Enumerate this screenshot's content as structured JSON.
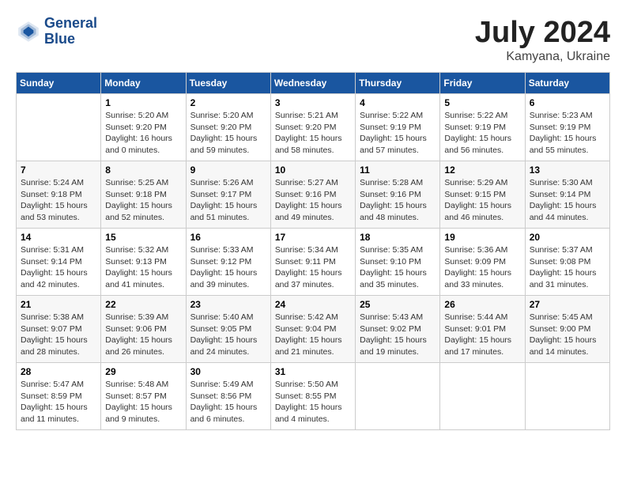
{
  "header": {
    "logo_line1": "General",
    "logo_line2": "Blue",
    "main_title": "July 2024",
    "subtitle": "Kamyana, Ukraine"
  },
  "calendar": {
    "weekdays": [
      "Sunday",
      "Monday",
      "Tuesday",
      "Wednesday",
      "Thursday",
      "Friday",
      "Saturday"
    ],
    "weeks": [
      [
        {
          "day": "",
          "sunrise": "",
          "sunset": "",
          "daylight": ""
        },
        {
          "day": "1",
          "sunrise": "Sunrise: 5:20 AM",
          "sunset": "Sunset: 9:20 PM",
          "daylight": "Daylight: 16 hours and 0 minutes."
        },
        {
          "day": "2",
          "sunrise": "Sunrise: 5:20 AM",
          "sunset": "Sunset: 9:20 PM",
          "daylight": "Daylight: 15 hours and 59 minutes."
        },
        {
          "day": "3",
          "sunrise": "Sunrise: 5:21 AM",
          "sunset": "Sunset: 9:20 PM",
          "daylight": "Daylight: 15 hours and 58 minutes."
        },
        {
          "day": "4",
          "sunrise": "Sunrise: 5:22 AM",
          "sunset": "Sunset: 9:19 PM",
          "daylight": "Daylight: 15 hours and 57 minutes."
        },
        {
          "day": "5",
          "sunrise": "Sunrise: 5:22 AM",
          "sunset": "Sunset: 9:19 PM",
          "daylight": "Daylight: 15 hours and 56 minutes."
        },
        {
          "day": "6",
          "sunrise": "Sunrise: 5:23 AM",
          "sunset": "Sunset: 9:19 PM",
          "daylight": "Daylight: 15 hours and 55 minutes."
        }
      ],
      [
        {
          "day": "7",
          "sunrise": "Sunrise: 5:24 AM",
          "sunset": "Sunset: 9:18 PM",
          "daylight": "Daylight: 15 hours and 53 minutes."
        },
        {
          "day": "8",
          "sunrise": "Sunrise: 5:25 AM",
          "sunset": "Sunset: 9:18 PM",
          "daylight": "Daylight: 15 hours and 52 minutes."
        },
        {
          "day": "9",
          "sunrise": "Sunrise: 5:26 AM",
          "sunset": "Sunset: 9:17 PM",
          "daylight": "Daylight: 15 hours and 51 minutes."
        },
        {
          "day": "10",
          "sunrise": "Sunrise: 5:27 AM",
          "sunset": "Sunset: 9:16 PM",
          "daylight": "Daylight: 15 hours and 49 minutes."
        },
        {
          "day": "11",
          "sunrise": "Sunrise: 5:28 AM",
          "sunset": "Sunset: 9:16 PM",
          "daylight": "Daylight: 15 hours and 48 minutes."
        },
        {
          "day": "12",
          "sunrise": "Sunrise: 5:29 AM",
          "sunset": "Sunset: 9:15 PM",
          "daylight": "Daylight: 15 hours and 46 minutes."
        },
        {
          "day": "13",
          "sunrise": "Sunrise: 5:30 AM",
          "sunset": "Sunset: 9:14 PM",
          "daylight": "Daylight: 15 hours and 44 minutes."
        }
      ],
      [
        {
          "day": "14",
          "sunrise": "Sunrise: 5:31 AM",
          "sunset": "Sunset: 9:14 PM",
          "daylight": "Daylight: 15 hours and 42 minutes."
        },
        {
          "day": "15",
          "sunrise": "Sunrise: 5:32 AM",
          "sunset": "Sunset: 9:13 PM",
          "daylight": "Daylight: 15 hours and 41 minutes."
        },
        {
          "day": "16",
          "sunrise": "Sunrise: 5:33 AM",
          "sunset": "Sunset: 9:12 PM",
          "daylight": "Daylight: 15 hours and 39 minutes."
        },
        {
          "day": "17",
          "sunrise": "Sunrise: 5:34 AM",
          "sunset": "Sunset: 9:11 PM",
          "daylight": "Daylight: 15 hours and 37 minutes."
        },
        {
          "day": "18",
          "sunrise": "Sunrise: 5:35 AM",
          "sunset": "Sunset: 9:10 PM",
          "daylight": "Daylight: 15 hours and 35 minutes."
        },
        {
          "day": "19",
          "sunrise": "Sunrise: 5:36 AM",
          "sunset": "Sunset: 9:09 PM",
          "daylight": "Daylight: 15 hours and 33 minutes."
        },
        {
          "day": "20",
          "sunrise": "Sunrise: 5:37 AM",
          "sunset": "Sunset: 9:08 PM",
          "daylight": "Daylight: 15 hours and 31 minutes."
        }
      ],
      [
        {
          "day": "21",
          "sunrise": "Sunrise: 5:38 AM",
          "sunset": "Sunset: 9:07 PM",
          "daylight": "Daylight: 15 hours and 28 minutes."
        },
        {
          "day": "22",
          "sunrise": "Sunrise: 5:39 AM",
          "sunset": "Sunset: 9:06 PM",
          "daylight": "Daylight: 15 hours and 26 minutes."
        },
        {
          "day": "23",
          "sunrise": "Sunrise: 5:40 AM",
          "sunset": "Sunset: 9:05 PM",
          "daylight": "Daylight: 15 hours and 24 minutes."
        },
        {
          "day": "24",
          "sunrise": "Sunrise: 5:42 AM",
          "sunset": "Sunset: 9:04 PM",
          "daylight": "Daylight: 15 hours and 21 minutes."
        },
        {
          "day": "25",
          "sunrise": "Sunrise: 5:43 AM",
          "sunset": "Sunset: 9:02 PM",
          "daylight": "Daylight: 15 hours and 19 minutes."
        },
        {
          "day": "26",
          "sunrise": "Sunrise: 5:44 AM",
          "sunset": "Sunset: 9:01 PM",
          "daylight": "Daylight: 15 hours and 17 minutes."
        },
        {
          "day": "27",
          "sunrise": "Sunrise: 5:45 AM",
          "sunset": "Sunset: 9:00 PM",
          "daylight": "Daylight: 15 hours and 14 minutes."
        }
      ],
      [
        {
          "day": "28",
          "sunrise": "Sunrise: 5:47 AM",
          "sunset": "Sunset: 8:59 PM",
          "daylight": "Daylight: 15 hours and 11 minutes."
        },
        {
          "day": "29",
          "sunrise": "Sunrise: 5:48 AM",
          "sunset": "Sunset: 8:57 PM",
          "daylight": "Daylight: 15 hours and 9 minutes."
        },
        {
          "day": "30",
          "sunrise": "Sunrise: 5:49 AM",
          "sunset": "Sunset: 8:56 PM",
          "daylight": "Daylight: 15 hours and 6 minutes."
        },
        {
          "day": "31",
          "sunrise": "Sunrise: 5:50 AM",
          "sunset": "Sunset: 8:55 PM",
          "daylight": "Daylight: 15 hours and 4 minutes."
        },
        {
          "day": "",
          "sunrise": "",
          "sunset": "",
          "daylight": ""
        },
        {
          "day": "",
          "sunrise": "",
          "sunset": "",
          "daylight": ""
        },
        {
          "day": "",
          "sunrise": "",
          "sunset": "",
          "daylight": ""
        }
      ]
    ]
  }
}
